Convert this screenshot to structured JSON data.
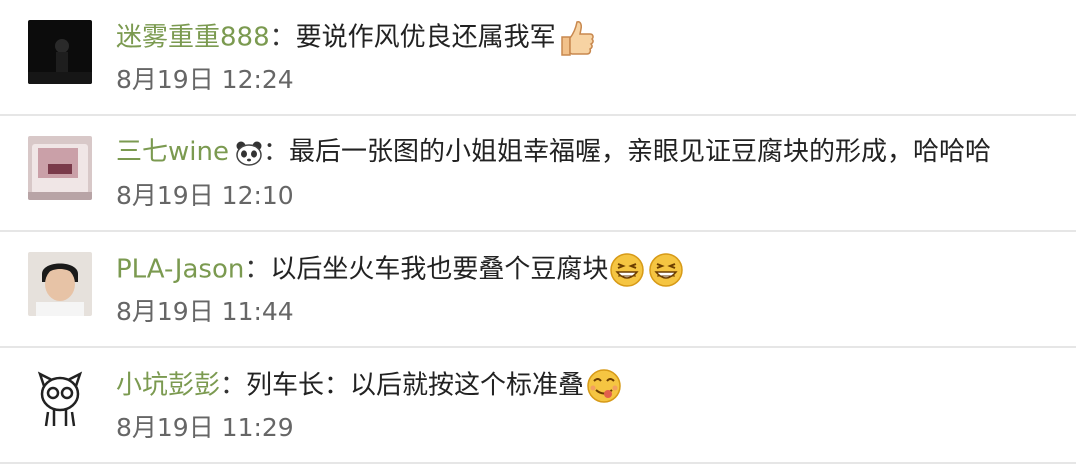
{
  "comments": [
    {
      "username": "迷雾重重888",
      "separator": "：",
      "text": "要说作风优良还属我军",
      "timestamp": "8月19日  12:24",
      "trailing_emoji": "thumbs-up-icon"
    },
    {
      "username": "三七wine",
      "separator": "：",
      "text": "最后一张图的小姐姐幸福喔，亲眼见证豆腐块的形成，哈哈哈",
      "timestamp": "8月19日  12:10",
      "name_emoji": "panda-icon"
    },
    {
      "username": "PLA-Jason",
      "separator": "：",
      "text": "以后坐火车我也要叠个豆腐块",
      "timestamp": "8月19日  11:44",
      "trailing_emoji": "grin-icon"
    },
    {
      "username": "小坑彭彭",
      "separator": "：",
      "text": "列车长：以后就按这个标准叠",
      "timestamp": "8月19日  11:29",
      "trailing_emoji": "yummy-face-icon"
    }
  ],
  "colors": {
    "username": "#7b9a50",
    "text": "#222222",
    "timestamp": "#666666",
    "divider": "#e6e6e6",
    "emoji": "#f5c542"
  }
}
